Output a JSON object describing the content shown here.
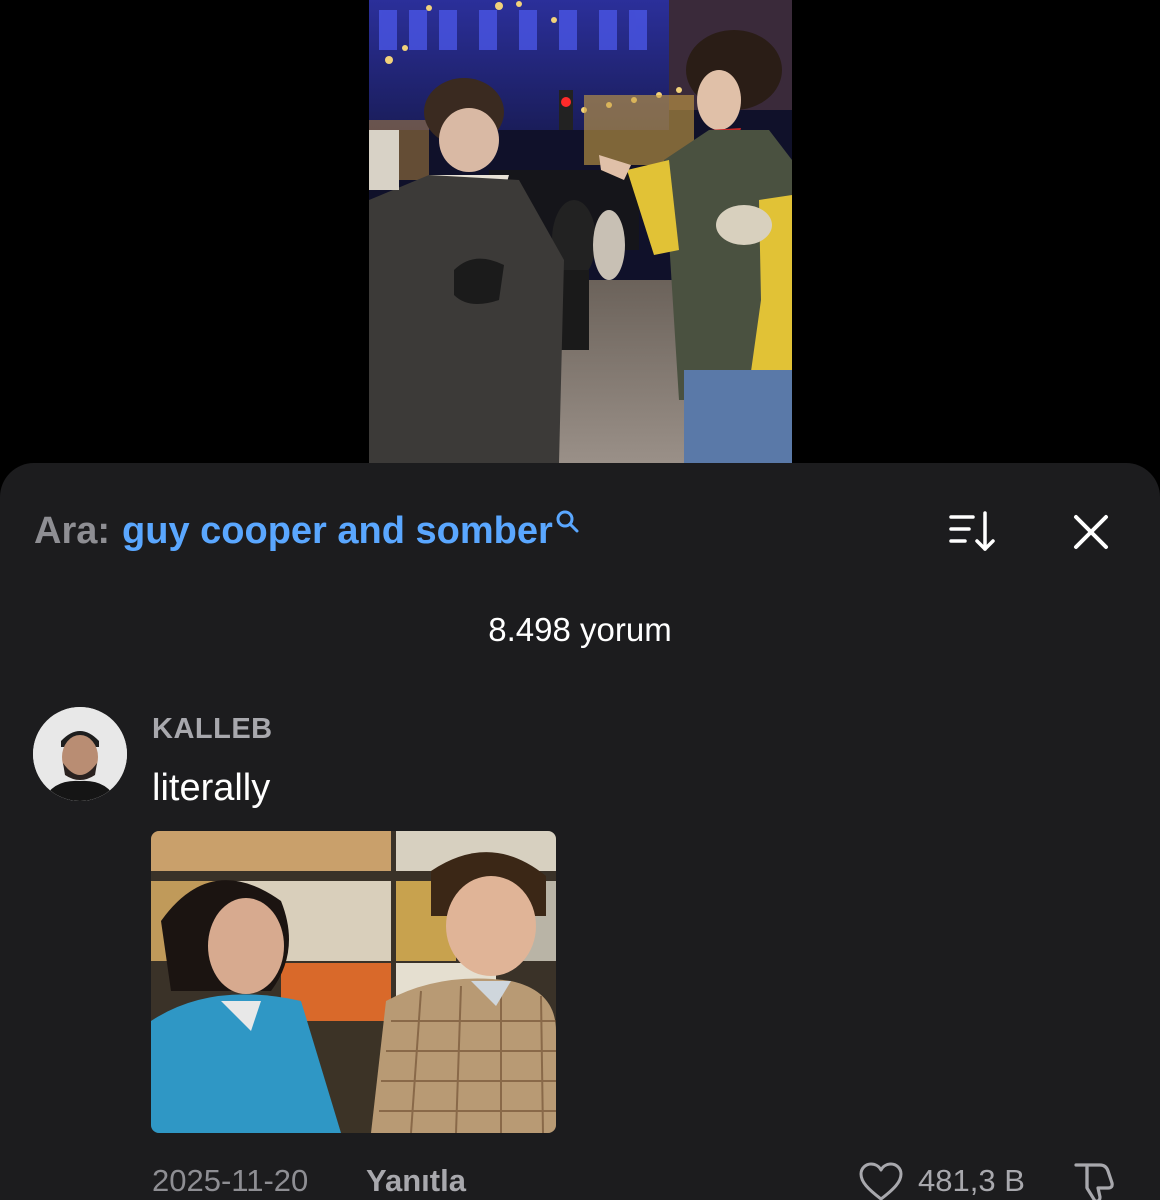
{
  "search": {
    "prefix": "Ara:",
    "query": "guy cooper and somber"
  },
  "header": {
    "sort_icon": "sort-icon",
    "close_icon": "close-icon"
  },
  "comments_count": "8.498 yorum",
  "comment": {
    "username": "KALLEB",
    "text": "literally",
    "date": "2025-11-20",
    "reply_label": "Yanıtla",
    "like_count": "481,3 B"
  },
  "colors": {
    "sheet_background": "#1c1c1e",
    "search_query": "#5aa7ff",
    "muted_text": "#8e8e93"
  }
}
